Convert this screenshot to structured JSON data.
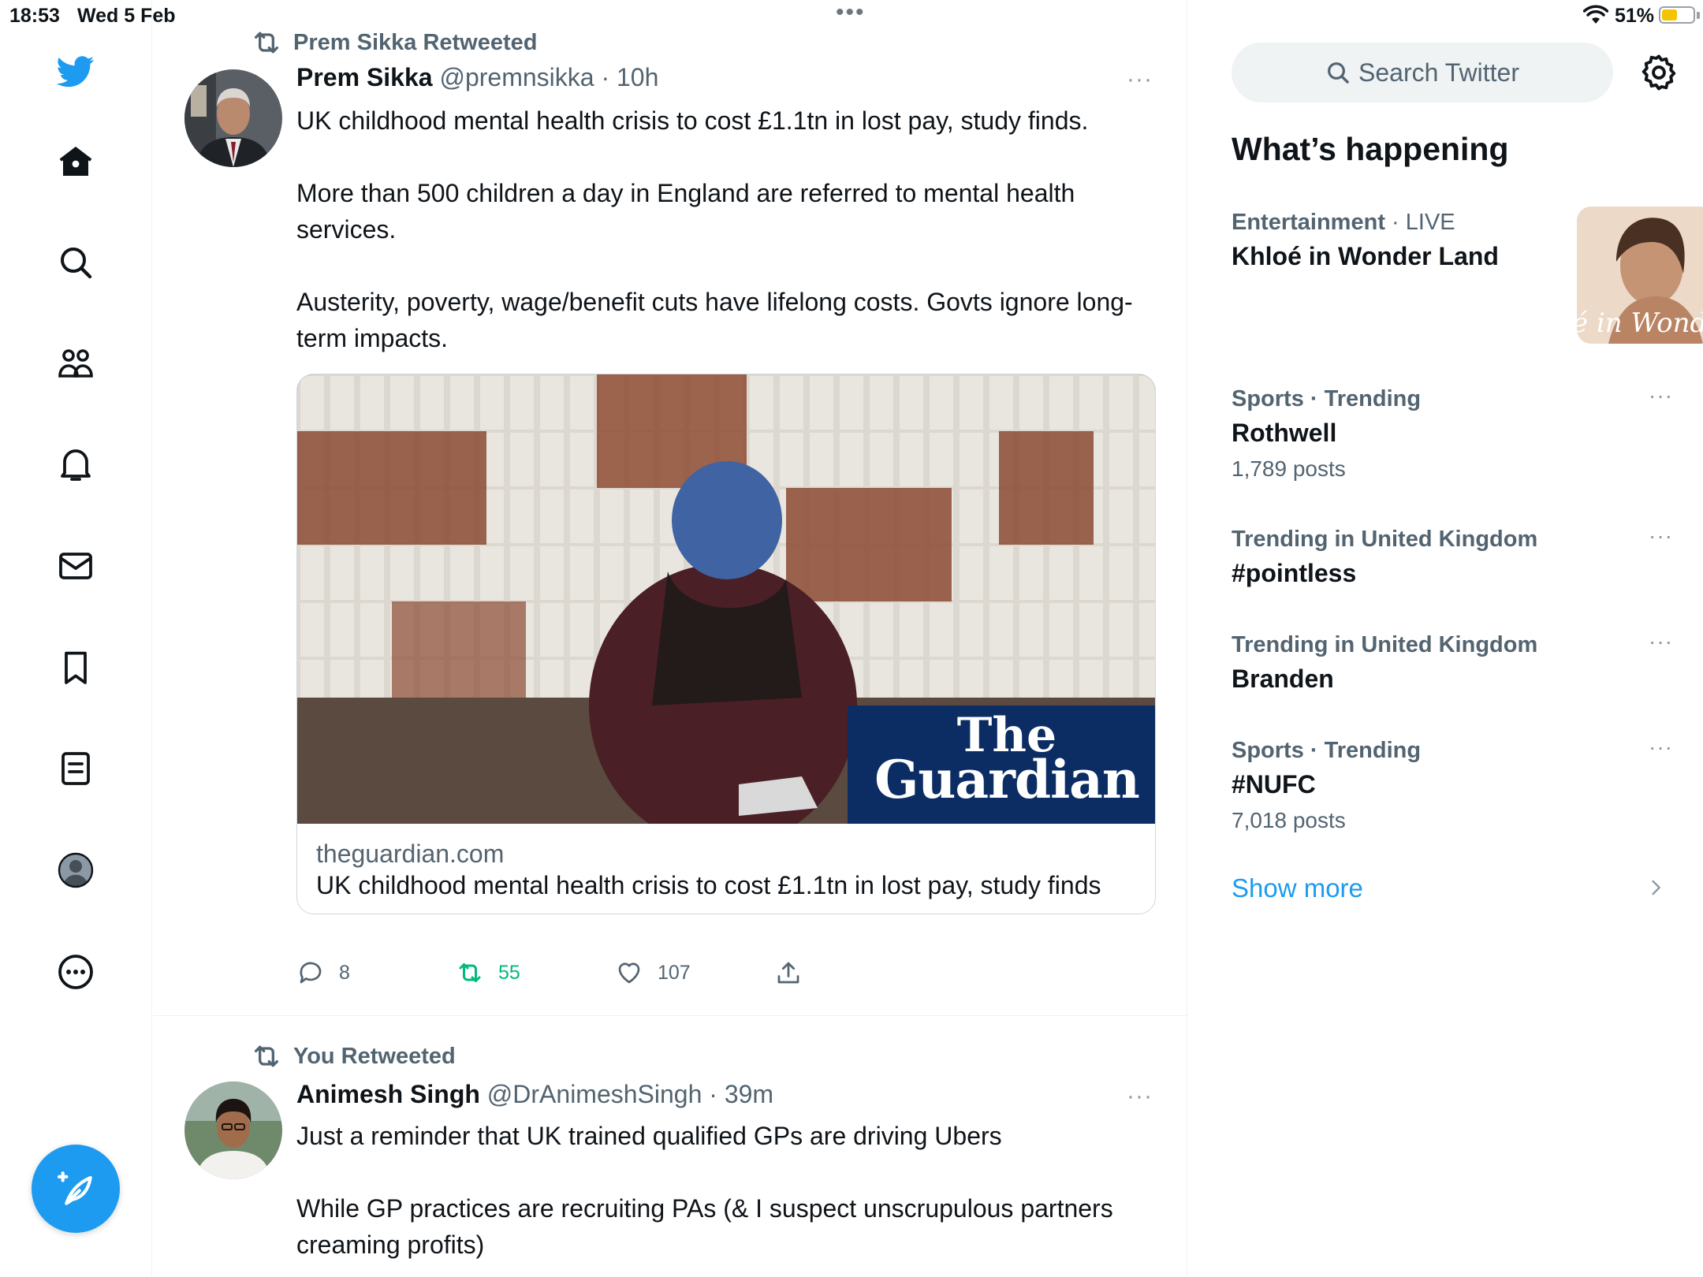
{
  "status_bar": {
    "time": "18:53",
    "date": "Wed 5 Feb",
    "battery": "51%",
    "battery_level": 0.51
  },
  "nav": {
    "icons": [
      "twitter-logo-icon",
      "home-icon",
      "search-icon",
      "communities-icon",
      "notifications-icon",
      "messages-icon",
      "bookmarks-icon",
      "lists-icon",
      "profile-icon",
      "more-icon"
    ],
    "compose_icon": "compose-tweet-icon",
    "accent": "#1d9bf0"
  },
  "tweets": [
    {
      "retweet_by": "Prem Sikka Retweeted",
      "name": "Prem Sikka",
      "handle": "@premnsikka",
      "time": "· 10h",
      "more": "···",
      "paragraphs": [
        "UK childhood mental health crisis to cost £1.1tn in lost pay, study finds.",
        "More than 500 children a day in England are referred to mental health services.",
        "Austerity, poverty, wage/benefit cuts have lifelong costs. Govts ignore long-term impacts."
      ],
      "card": {
        "brand_line1": "The",
        "brand_line2": "Guardian",
        "domain": "theguardian.com",
        "title": "UK childhood mental health crisis to cost £1.1tn in lost pay, study finds"
      },
      "actions": {
        "replies": "8",
        "retweets": "55",
        "likes": "107"
      }
    },
    {
      "retweet_by": "You Retweeted",
      "name": "Animesh Singh",
      "handle": "@DrAnimeshSingh",
      "time": "· 39m",
      "more": "···",
      "paragraphs": [
        "Just a reminder that UK trained qualified GPs are driving Ubers",
        "While GP practices are recruiting PAs (& I suspect unscrupulous partners creaming profits)"
      ]
    }
  ],
  "sidebar": {
    "search_placeholder": "Search Twitter",
    "section_title": "What’s happening",
    "trends": [
      {
        "category": "Entertainment",
        "meta": "· LIVE",
        "name": "Khloé in Wonder Land",
        "count": "",
        "image_caption": "é in Wonder L"
      },
      {
        "category": "Sports · Trending",
        "meta": "",
        "name": "Rothwell",
        "count": "1,789 posts"
      },
      {
        "category": "Trending in United Kingdom",
        "meta": "",
        "name": "#pointless",
        "count": ""
      },
      {
        "category": "Trending in United Kingdom",
        "meta": "",
        "name": "Branden",
        "count": ""
      },
      {
        "category": "Sports · Trending",
        "meta": "",
        "name": "#NUFC",
        "count": "7,018 posts"
      }
    ],
    "more_label": "···",
    "show_more": "Show more"
  }
}
